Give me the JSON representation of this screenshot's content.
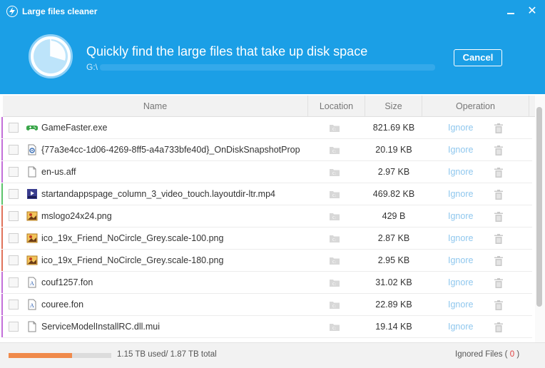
{
  "window": {
    "title": "Large files cleaner"
  },
  "header": {
    "headline": "Quickly find the large files that take up disk space",
    "path": "G:\\",
    "cancel_label": "Cancel"
  },
  "table": {
    "columns": [
      "Name",
      "Location",
      "Size",
      "Operation"
    ],
    "ignore_label": "Ignore",
    "rows": [
      {
        "name": "GameFaster.exe",
        "size": "821.69 KB",
        "stripe": "#c36fd9",
        "icon": "game-controller-icon"
      },
      {
        "name": "{77a3e4cc-1d06-4269-8ff5-a4a733bfe40d}_OnDiskSnapshotProp",
        "size": "20.19 KB",
        "stripe": "#c36fd9",
        "icon": "settings-file-icon"
      },
      {
        "name": "en-us.aff",
        "size": "2.97 KB",
        "stripe": "#c36fd9",
        "icon": "blank-file-icon"
      },
      {
        "name": "startandappspage_column_3_video_touch.layoutdir-ltr.mp4",
        "size": "469.82 KB",
        "stripe": "#5cc36b",
        "icon": "video-file-icon"
      },
      {
        "name": "mslogo24x24.png",
        "size": "429 B",
        "stripe": "#e0725a",
        "icon": "image-file-icon"
      },
      {
        "name": "ico_19x_Friend_NoCircle_Grey.scale-100.png",
        "size": "2.87 KB",
        "stripe": "#e0725a",
        "icon": "image-file-icon"
      },
      {
        "name": "ico_19x_Friend_NoCircle_Grey.scale-180.png",
        "size": "2.95 KB",
        "stripe": "#e0725a",
        "icon": "image-file-icon"
      },
      {
        "name": "couf1257.fon",
        "size": "31.02 KB",
        "stripe": "#c36fd9",
        "icon": "font-file-icon"
      },
      {
        "name": "couree.fon",
        "size": "22.89 KB",
        "stripe": "#c36fd9",
        "icon": "font-file-icon"
      },
      {
        "name": "ServiceModelInstallRC.dll.mui",
        "size": "19.14 KB",
        "stripe": "#c36fd9",
        "icon": "blank-file-icon"
      }
    ]
  },
  "footer": {
    "used": "1.15 TB",
    "used_label": "used/",
    "total": "1.87 TB",
    "total_label": "total",
    "usage_fraction": 0.615,
    "ignored_label": "Ignored Files",
    "ignored_count": "0"
  },
  "colors": {
    "accent": "#1b9fe6",
    "progress": "#f08a4b",
    "ignore_link": "#8fc7ee"
  }
}
